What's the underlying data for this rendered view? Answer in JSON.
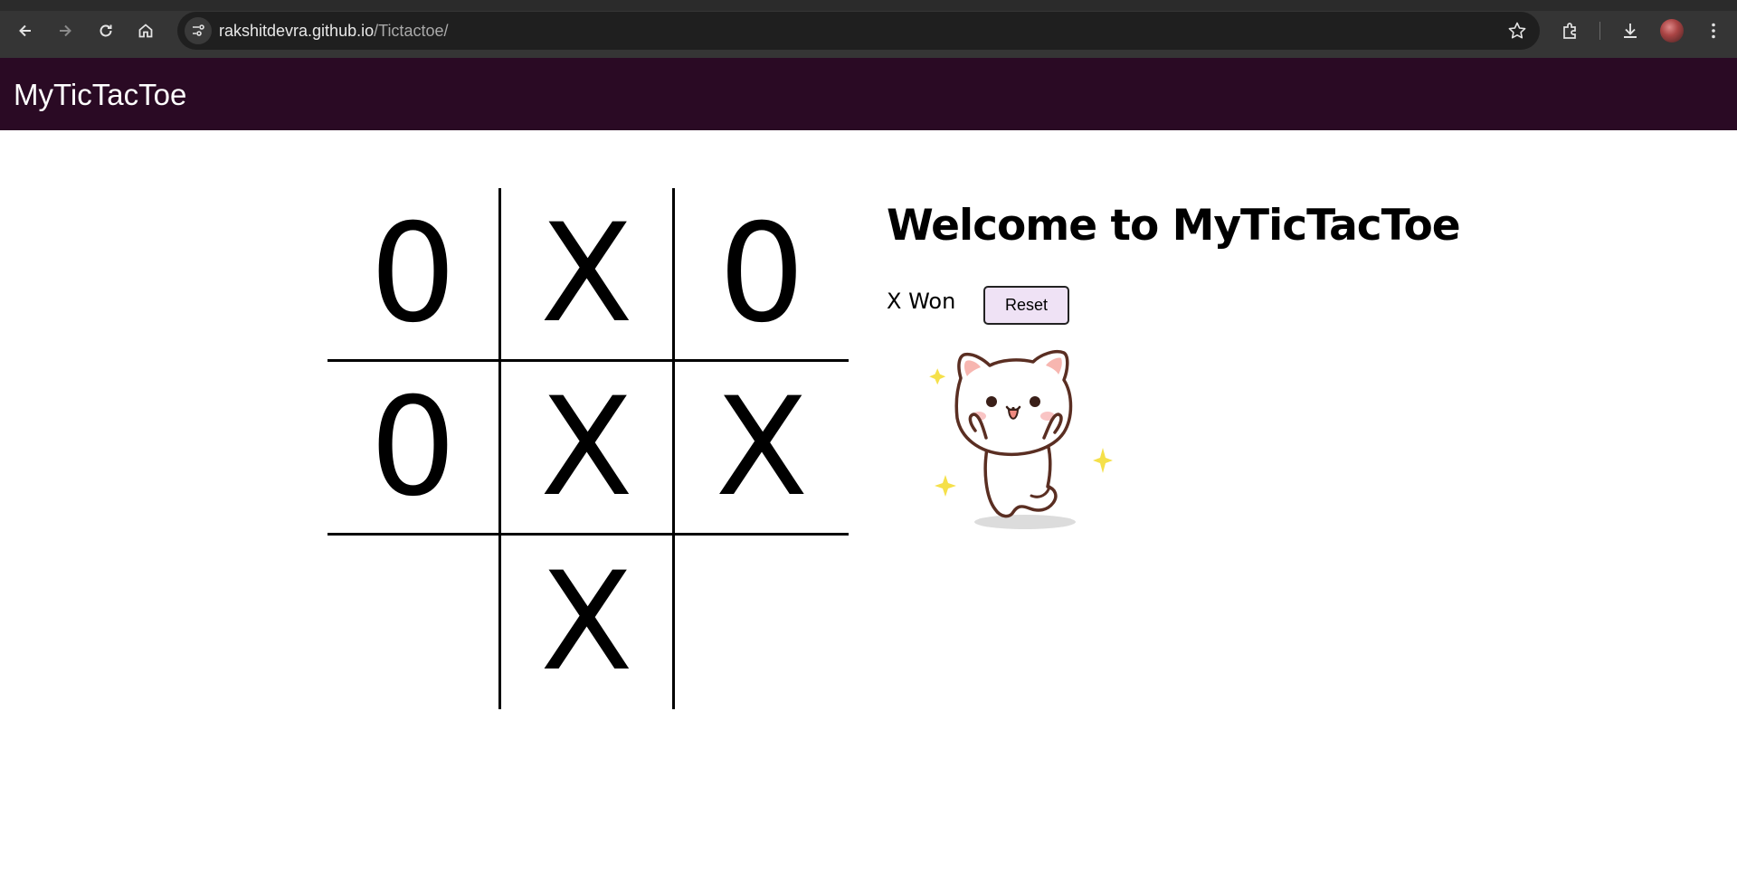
{
  "browser": {
    "url_host": "rakshitdevra.github.io",
    "url_path": "/Tictactoe/",
    "icons": [
      "back-icon",
      "forward-icon",
      "reload-icon",
      "home-icon",
      "site-info-icon",
      "bookmark-star-icon",
      "extensions-icon",
      "download-icon",
      "profile-avatar",
      "menu-kebab-icon"
    ]
  },
  "header": {
    "title": "MyTicTacToe",
    "background": "#2a0a24"
  },
  "board": {
    "cells": [
      "0",
      "X",
      "0",
      "0",
      "X",
      "X",
      "",
      "X",
      ""
    ]
  },
  "panel": {
    "welcome": "Welcome to MyTicTacToe",
    "status": "X Won",
    "reset_label": "Reset",
    "reset_bg": "#efe2f5",
    "image": "celebrating-cat"
  }
}
